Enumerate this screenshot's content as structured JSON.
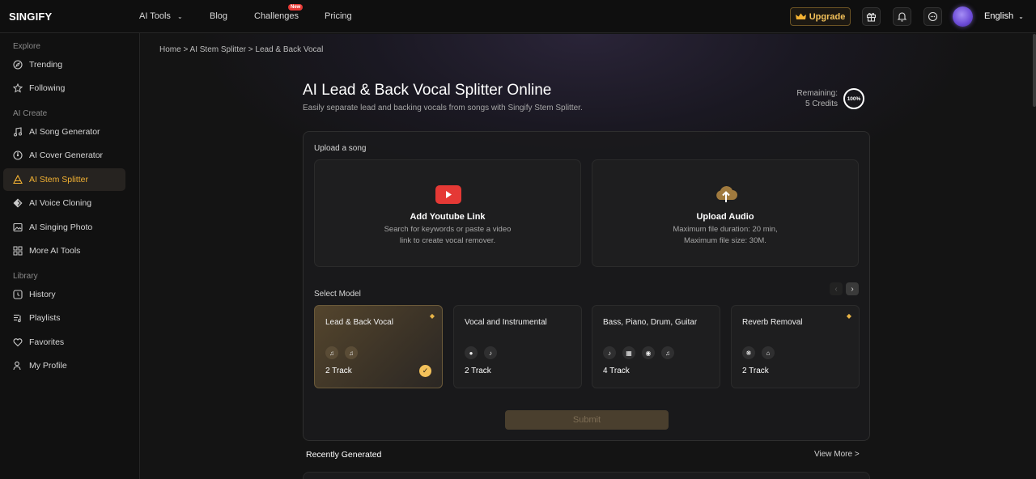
{
  "header": {
    "logo": "SINGIFY",
    "nav": {
      "ai_tools": "AI Tools",
      "blog": "Blog",
      "challenges": "Challenges",
      "new_badge": "New",
      "pricing": "Pricing"
    },
    "upgrade": "Upgrade",
    "language": "English"
  },
  "sidebar": {
    "explore_label": "Explore",
    "trending": "Trending",
    "following": "Following",
    "ai_create_label": "AI Create",
    "song_generator": "AI Song Generator",
    "cover_generator": "AI Cover Generator",
    "stem_splitter": "AI Stem Splitter",
    "voice_cloning": "AI Voice Cloning",
    "singing_photo": "AI Singing Photo",
    "more_tools": "More AI Tools",
    "library_label": "Library",
    "history": "History",
    "playlists": "Playlists",
    "favorites": "Favorites",
    "my_profile": "My Profile"
  },
  "main": {
    "breadcrumb": "Home > AI Stem Splitter > Lead & Back Vocal",
    "title": "AI Lead & Back Vocal Splitter Online",
    "subtitle": "Easily separate lead and backing vocals from songs with Singify Stem Splitter.",
    "remaining_label": "Remaining:",
    "remaining_credits": "5 Credits",
    "remaining_percent": "100%",
    "upload_label": "Upload a song",
    "youtube": {
      "title": "Add Youtube Link",
      "desc_1": "Search for keywords or paste a video",
      "desc_2": "link to create vocal remover."
    },
    "audio": {
      "title": "Upload Audio",
      "desc_1": "Maximum file duration: 20 min,",
      "desc_2": "Maximum file size: 30M."
    },
    "select_model_label": "Select Model",
    "models": [
      {
        "title": "Lead & Back Vocal",
        "track": "2 Track"
      },
      {
        "title": "Vocal and Instrumental",
        "track": "2 Track"
      },
      {
        "title": "Bass, Piano, Drum, Guitar",
        "track": "4 Track"
      },
      {
        "title": "Reverb Removal",
        "track": "2 Track"
      }
    ],
    "submit": "Submit",
    "recent_label": "Recently Generated",
    "view_more": "View More >"
  },
  "colors": {
    "accent": "#f3b233",
    "youtube_red": "#e53935",
    "background": "#141414"
  }
}
